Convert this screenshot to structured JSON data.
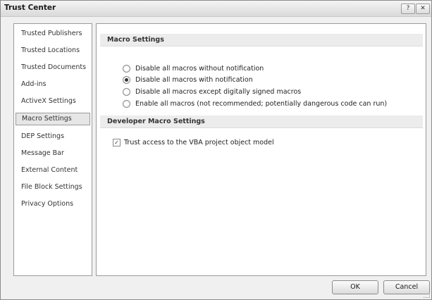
{
  "window": {
    "title": "Trust Center",
    "help_glyph": "?",
    "close_glyph": "✕"
  },
  "sidebar": {
    "items": [
      {
        "label": "Trusted Publishers"
      },
      {
        "label": "Trusted Locations"
      },
      {
        "label": "Trusted Documents"
      },
      {
        "label": "Add-ins"
      },
      {
        "label": "ActiveX Settings"
      },
      {
        "label": "Macro Settings",
        "selected": true
      },
      {
        "label": "DEP Settings"
      },
      {
        "label": "Message Bar"
      },
      {
        "label": "External Content"
      },
      {
        "label": "File Block Settings"
      },
      {
        "label": "Privacy Options"
      }
    ]
  },
  "macro_settings": {
    "header": "Macro Settings",
    "selected_option": 1,
    "options": [
      {
        "label": "Disable all macros without notification"
      },
      {
        "label": "Disable all macros with notification"
      },
      {
        "label": "Disable all macros except digitally signed macros"
      },
      {
        "label": "Enable all macros (not recommended; potentially dangerous code can run)"
      }
    ]
  },
  "developer_settings": {
    "header": "Developer Macro Settings",
    "vba_label": "Trust access to the VBA project object model",
    "vba_checked": true,
    "check_glyph": "✓"
  },
  "buttons": {
    "ok": "OK",
    "cancel": "Cancel"
  }
}
